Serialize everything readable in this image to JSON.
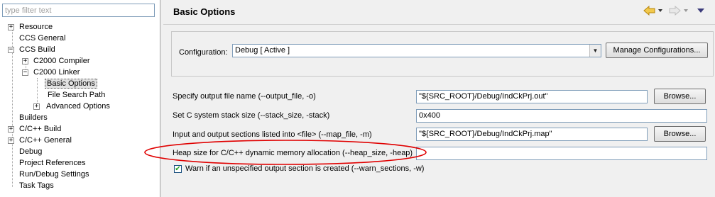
{
  "filter": {
    "placeholder": "type filter text"
  },
  "tree": {
    "resource": "Resource",
    "ccs_general": "CCS General",
    "ccs_build": "CCS Build",
    "c2000_compiler": "C2000 Compiler",
    "c2000_linker": "C2000 Linker",
    "basic_options": "Basic Options",
    "file_search_path": "File Search Path",
    "advanced_options": "Advanced Options",
    "builders": "Builders",
    "cc_build": "C/C++ Build",
    "cc_general": "C/C++ General",
    "debug": "Debug",
    "project_references": "Project References",
    "run_debug_settings": "Run/Debug Settings",
    "task_tags": "Task Tags"
  },
  "page": {
    "title": "Basic Options"
  },
  "config": {
    "label": "Configuration:",
    "selected": "Debug  [ Active ]",
    "manage_label": "Manage Configurations..."
  },
  "options": {
    "output_file_label": "Specify output file name (--output_file, -o)",
    "output_file_value": "\"${SRC_ROOT}/Debug/IndCkPrj.out\"",
    "stack_size_label": "Set C system stack size (--stack_size, -stack)",
    "stack_size_value": "0x400",
    "map_file_label": "Input and output sections listed into <file> (--map_file, -m)",
    "map_file_value": "\"${SRC_ROOT}/Debug/IndCkPrj.map\"",
    "heap_size_label": "Heap size for C/C++ dynamic memory allocation (--heap_size, -heap)",
    "heap_size_value": "",
    "warn_label": "Warn if an unspecified output section is created (--warn_sections, -w)",
    "warn_checked": true,
    "browse_label": "Browse..."
  },
  "colors": {
    "annotation": "#e00000",
    "selection": "#e1e1e1"
  }
}
